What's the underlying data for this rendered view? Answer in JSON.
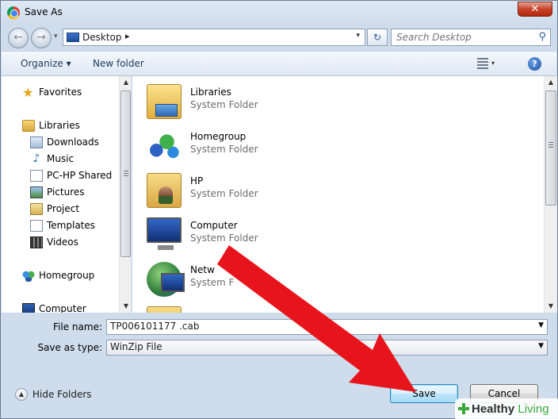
{
  "window": {
    "title": "Save As",
    "close_label": "✕"
  },
  "address": {
    "location": "Desktop",
    "chevron": "▸",
    "dropdown": "▾",
    "refresh": "↻"
  },
  "search": {
    "placeholder": "Search Desktop"
  },
  "toolbar": {
    "organize_label": "Organize ▾",
    "new_folder_label": "New folder",
    "help_label": "?"
  },
  "nav": {
    "favorites": "Favorites",
    "libraries": "Libraries",
    "library_items": [
      "Downloads",
      "Music",
      "PC-HP Shared",
      "Pictures",
      "Project",
      "Templates",
      "Videos"
    ],
    "homegroup": "Homegroup",
    "computer": "Computer"
  },
  "files": [
    {
      "name": "Libraries",
      "type": "System Folder",
      "icon": "libraries-icon"
    },
    {
      "name": "Homegroup",
      "type": "System Folder",
      "icon": "homegroup-icon"
    },
    {
      "name": "HP",
      "type": "System Folder",
      "icon": "user-folder-icon"
    },
    {
      "name": "Computer",
      "type": "System Folder",
      "icon": "computer-icon"
    },
    {
      "name": "Netw",
      "type": "System F",
      "icon": "network-icon"
    },
    {
      "name": "",
      "type": "",
      "icon": "folder-icon"
    }
  ],
  "form": {
    "file_name_label": "File name:",
    "file_name_value": "TP006101177 .cab",
    "save_type_label": "Save as type:",
    "save_type_value": "WinZip File"
  },
  "footer": {
    "hide_folders_label": "Hide Folders"
  },
  "buttons": {
    "save": "Save",
    "cancel": "Cancel"
  },
  "watermark": {
    "brand_part1": "Healthy",
    "brand_part2": " Living"
  },
  "colors": {
    "arrow": "#e8141c",
    "accent": "#3c7fb1",
    "brand_green": "#3aa83a"
  }
}
